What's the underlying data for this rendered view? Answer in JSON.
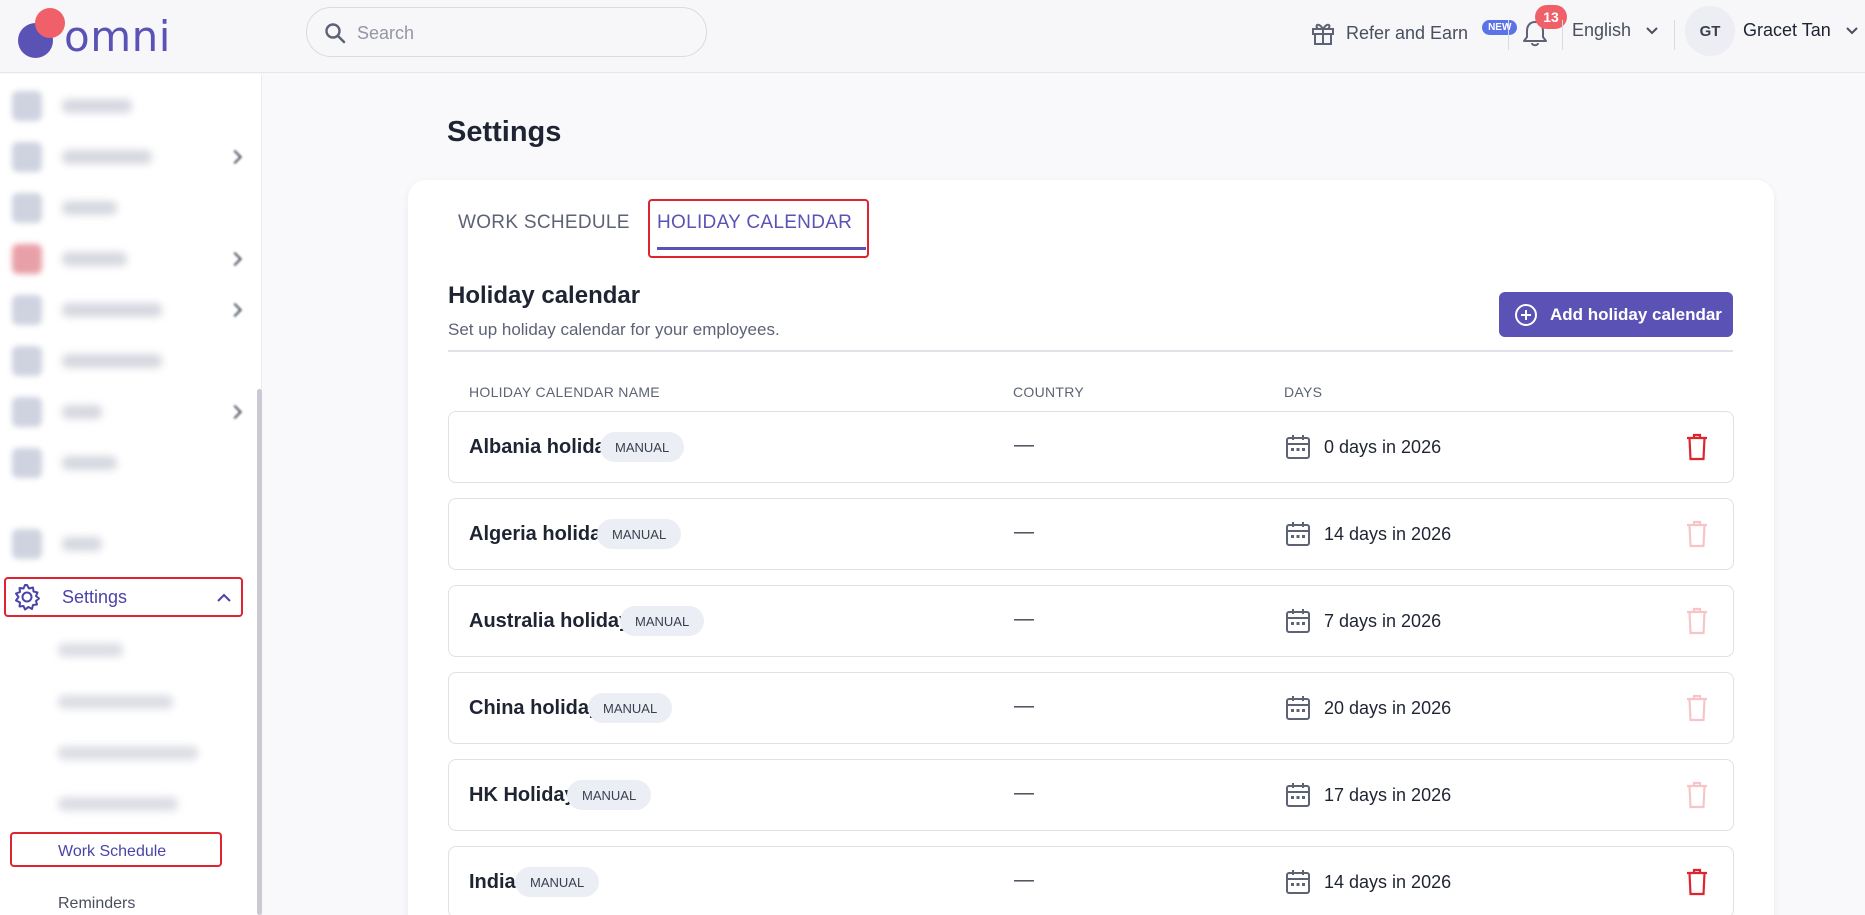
{
  "header": {
    "logo_text": "omni",
    "search_placeholder": "Search",
    "refer_label": "Refer and Earn",
    "new_badge": "NEW",
    "notification_count": "13",
    "language": "English",
    "user_initials": "GT",
    "user_name": "Gracet Tan"
  },
  "sidebar": {
    "settings_label": "Settings",
    "work_schedule_label": "Work Schedule",
    "reminders_label": "Reminders"
  },
  "main": {
    "page_title": "Settings",
    "tabs": [
      {
        "label": "WORK SCHEDULE",
        "active": false
      },
      {
        "label": "HOLIDAY CALENDAR",
        "active": true
      }
    ],
    "section_title": "Holiday calendar",
    "section_subtitle": "Set up holiday calendar for your employees.",
    "add_button_label": "Add holiday calendar",
    "columns": [
      "HOLIDAY CALENDAR NAME",
      "COUNTRY",
      "DAYS"
    ],
    "rows": [
      {
        "name": "Albania holidays",
        "type": "MANUAL",
        "country": "—",
        "days": "0 days in 2026",
        "delete_enabled": true
      },
      {
        "name": "Algeria holidays",
        "type": "MANUAL",
        "country": "—",
        "days": "14 days in 2026",
        "delete_enabled": false
      },
      {
        "name": "Australia holidays",
        "type": "MANUAL",
        "country": "—",
        "days": "7 days in 2026",
        "delete_enabled": false
      },
      {
        "name": "China holidays",
        "type": "MANUAL",
        "country": "—",
        "days": "20 days in 2026",
        "delete_enabled": false
      },
      {
        "name": "HK Holidays",
        "type": "MANUAL",
        "country": "—",
        "days": "17 days in 2026",
        "delete_enabled": false
      },
      {
        "name": "India",
        "type": "MANUAL",
        "country": "—",
        "days": "14 days in 2026",
        "delete_enabled": true
      }
    ]
  },
  "colors": {
    "brand": "#5b52b6",
    "highlight_box": "#e0242f",
    "delete_enabled": "#e0242f",
    "delete_disabled": "#f7c5c8"
  }
}
